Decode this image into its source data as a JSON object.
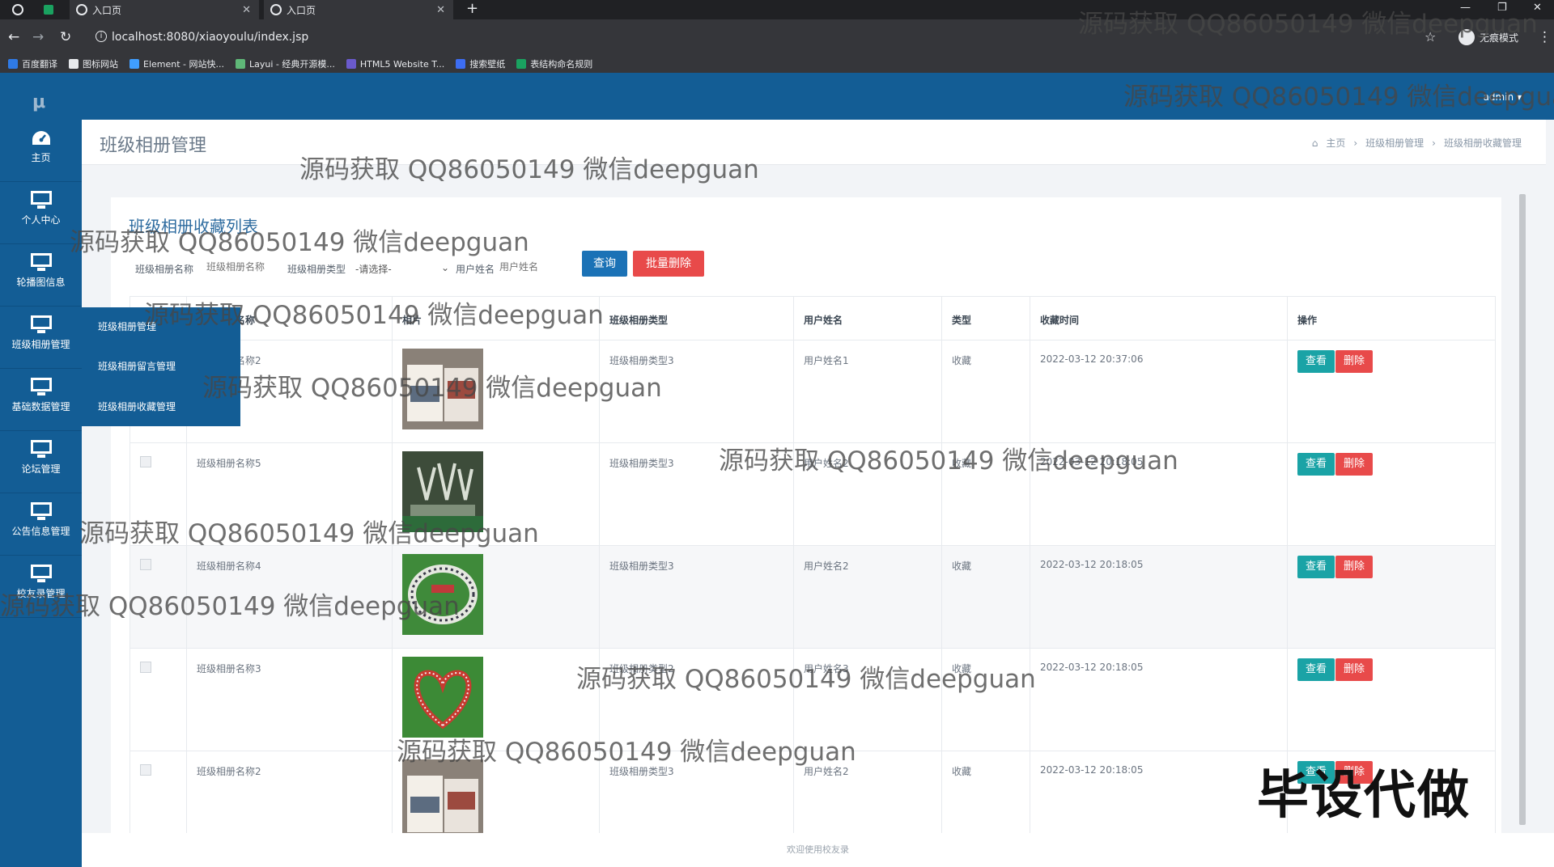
{
  "browser": {
    "tabs": [
      {
        "label": "入口页"
      },
      {
        "label": "入口页"
      }
    ],
    "url": "localhost:8080/xiaoyoulu/index.jsp",
    "profile_label": "无痕模式",
    "bookmarks": [
      {
        "label": "百度翻译",
        "color": "#2f7ae5"
      },
      {
        "label": "图标网站",
        "color": "#222222"
      },
      {
        "label": "Element - 网站快...",
        "color": "#409eff"
      },
      {
        "label": "Layui - 经典开源模...",
        "color": "#5fb878"
      },
      {
        "label": "HTML5 Website T...",
        "color": "#6a5acd"
      },
      {
        "label": "搜索壁纸",
        "color": "#3d6df2"
      },
      {
        "label": "表结构命名规则",
        "color": "#1aa260"
      }
    ]
  },
  "app": {
    "logo": "μ",
    "user": "admin ▾",
    "sidebar": [
      {
        "label": "主页",
        "icon": "dashboard-icon"
      },
      {
        "label": "个人中心",
        "icon": "monitor-icon"
      },
      {
        "label": "轮播图信息",
        "icon": "monitor-icon"
      },
      {
        "label": "班级相册管理",
        "icon": "monitor-icon"
      },
      {
        "label": "基础数据管理",
        "icon": "monitor-icon"
      },
      {
        "label": "论坛管理",
        "icon": "monitor-icon"
      },
      {
        "label": "公告信息管理",
        "icon": "monitor-icon"
      },
      {
        "label": "校友录管理",
        "icon": "monitor-icon"
      }
    ],
    "submenu": [
      "班级相册管理",
      "班级相册留言管理",
      "班级相册收藏管理"
    ],
    "page_title": "班级相册管理",
    "breadcrumb": [
      "主页",
      "班级相册管理",
      "班级相册收藏管理"
    ],
    "card_title": "班级相册收藏列表",
    "filters": {
      "album_name_label": "班级相册名称",
      "album_name_placeholder": "班级相册名称",
      "album_type_label": "班级相册类型",
      "album_type_value": "-请选择-",
      "user_name_label": "用户姓名",
      "user_name_placeholder": "用户姓名"
    },
    "buttons": {
      "search": "查询",
      "batch_delete": "批量删除",
      "view": "查看",
      "delete": "删除"
    },
    "table": {
      "headers": [
        "",
        "班级相册名称",
        "相片",
        "班级相册类型",
        "用户姓名",
        "类型",
        "收藏时间",
        "操作"
      ],
      "rows": [
        {
          "name": "班级相册名称2",
          "type": "班级相册类型3",
          "user": "用户姓名1",
          "kind": "收藏",
          "time": "2022-03-12 20:37:06",
          "photo": "group-photo-album"
        },
        {
          "name": "班级相册名称5",
          "type": "班级相册类型3",
          "user": "用户姓名2",
          "kind": "收藏",
          "time": "2022-03-12 20:18:05",
          "photo": "trophy-photo"
        },
        {
          "name": "班级相册名称4",
          "type": "班级相册类型3",
          "user": "用户姓名2",
          "kind": "收藏",
          "time": "2022-03-12 20:18:05",
          "photo": "circle-formation-photo"
        },
        {
          "name": "班级相册名称3",
          "type": "班级相册类型2",
          "user": "用户姓名3",
          "kind": "收藏",
          "time": "2022-03-12 20:18:05",
          "photo": "heart-formation-photo"
        },
        {
          "name": "班级相册名称2",
          "type": "班级相册类型3",
          "user": "用户姓名2",
          "kind": "收藏",
          "time": "2022-03-12 20:18:05",
          "photo": "group-photo-album"
        }
      ]
    },
    "footer": "欢迎使用校友录"
  },
  "watermark": {
    "text": "源码获取 QQ86050149 微信deepguan",
    "badge": "毕设代做"
  }
}
